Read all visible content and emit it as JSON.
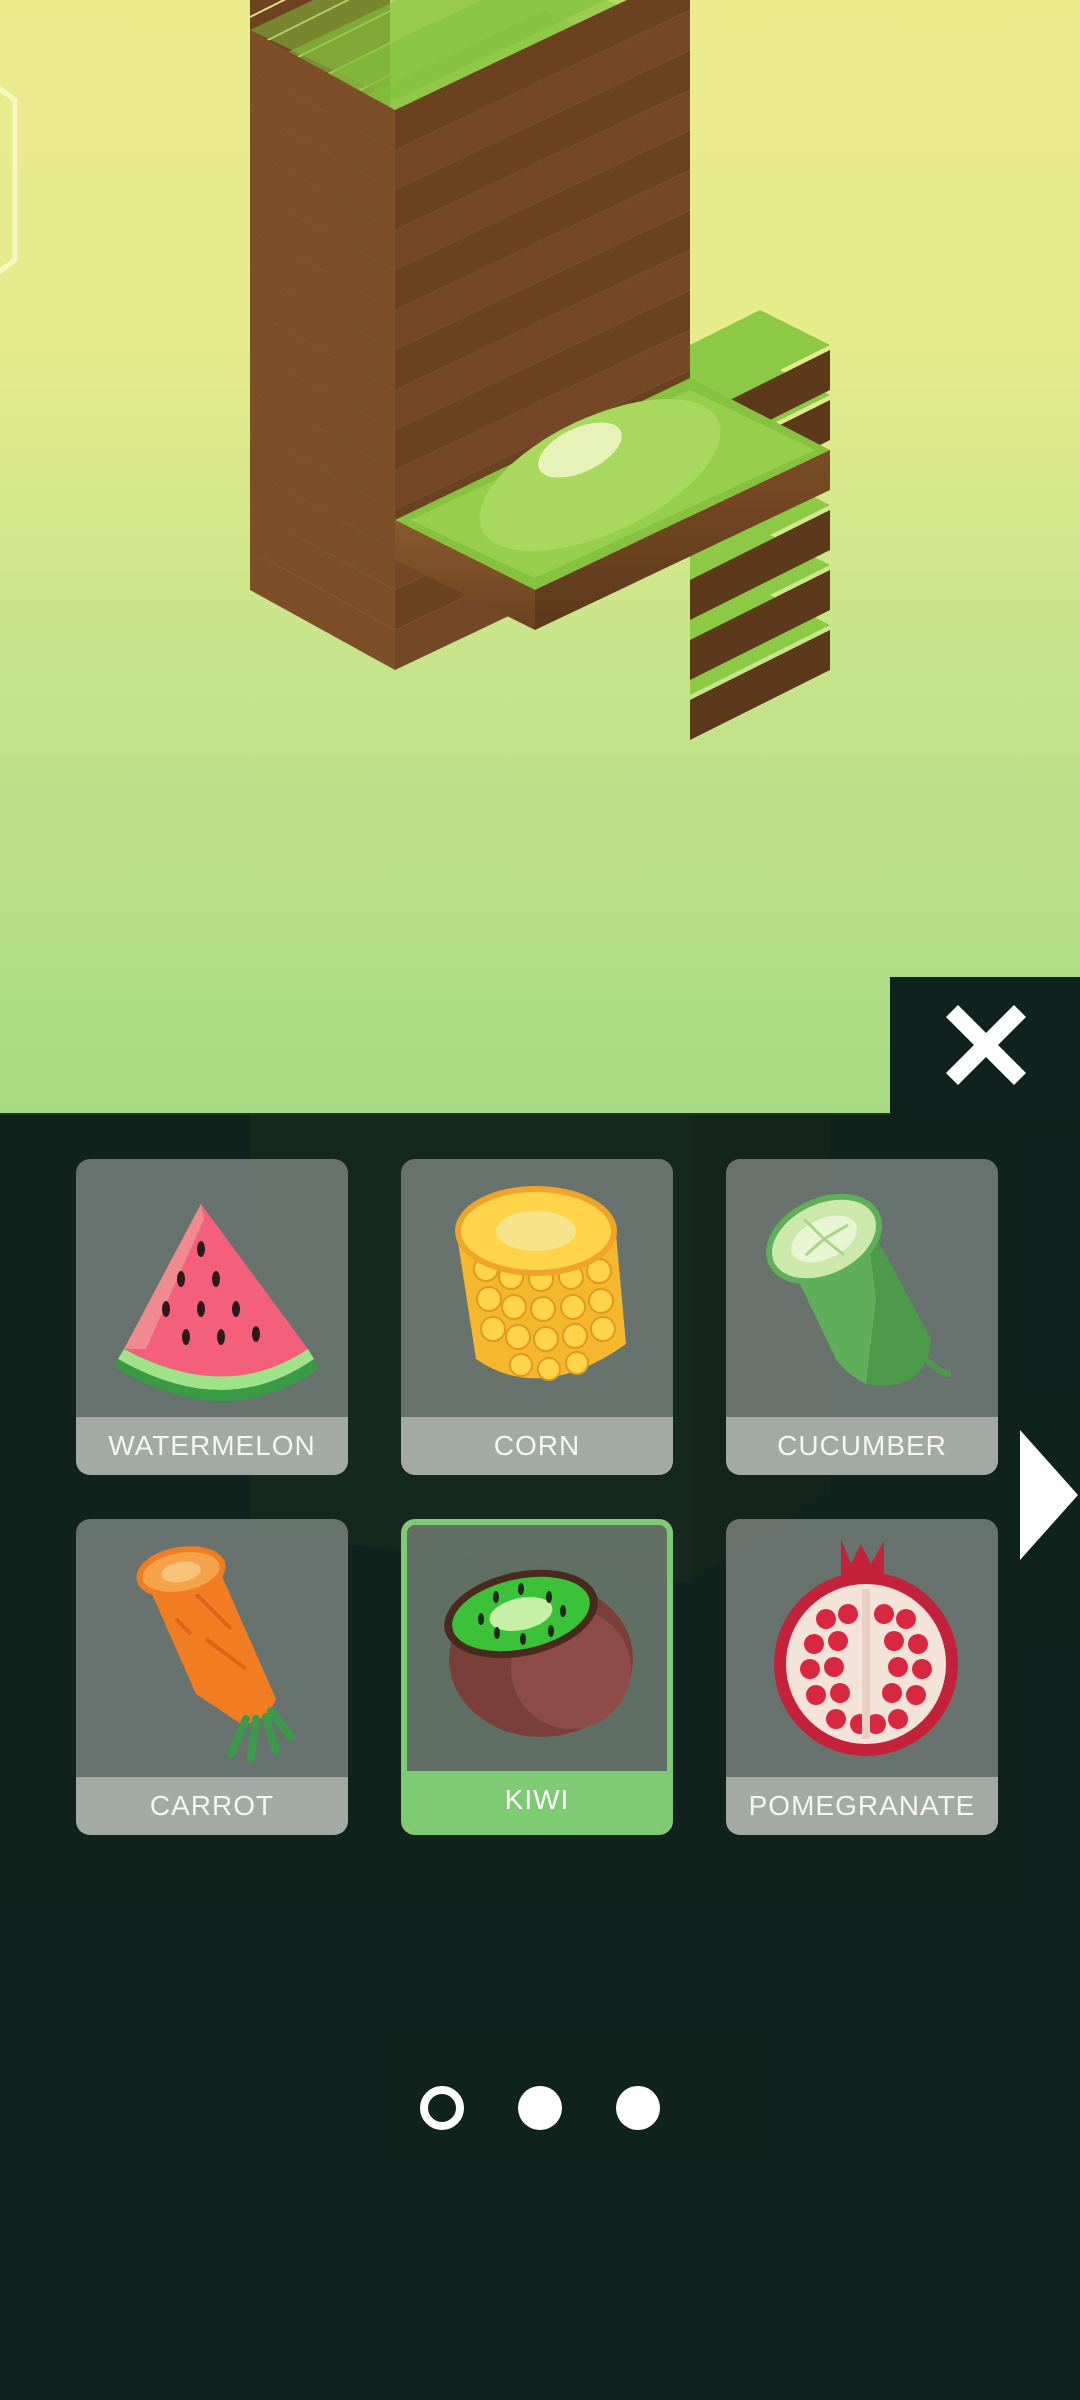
{
  "close_button": {
    "icon": "close-icon",
    "label": "Close"
  },
  "navigation": {
    "next_icon": "chevron-right-icon"
  },
  "skins": [
    {
      "name": "WATERMELON",
      "icon": "watermelon-icon",
      "selected": false
    },
    {
      "name": "CORN",
      "icon": "corn-icon",
      "selected": false
    },
    {
      "name": "CUCUMBER",
      "icon": "cucumber-icon",
      "selected": false
    },
    {
      "name": "CARROT",
      "icon": "carrot-icon",
      "selected": false
    },
    {
      "name": "KIWI",
      "icon": "kiwi-icon",
      "selected": true
    },
    {
      "name": "POMEGRANATE",
      "icon": "pomegranate-icon",
      "selected": false
    }
  ],
  "pagination": {
    "pages": 3,
    "current": 1
  },
  "colors": {
    "accent": "#7fcb74",
    "panel": "#10221d",
    "sky_top": "#ebeb8c",
    "sky_bottom": "#a8da84"
  }
}
